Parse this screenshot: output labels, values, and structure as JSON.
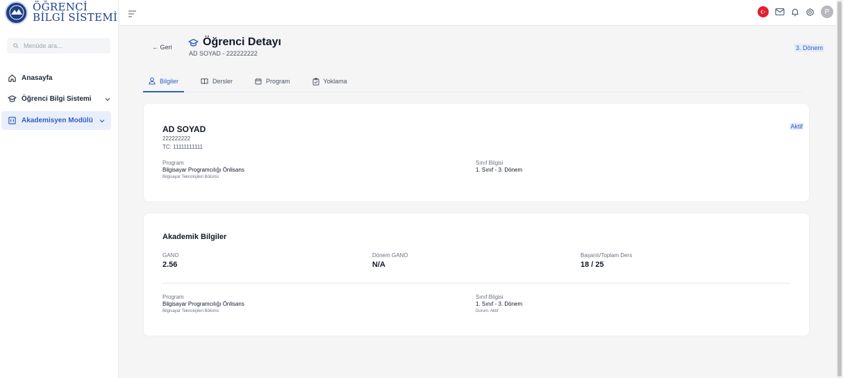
{
  "app": {
    "logo_line1": "ÖĞRENCİ",
    "logo_line2": "BİLGİ SİSTEMİ"
  },
  "sidebar": {
    "search_placeholder": "Menüde ara...",
    "items": [
      {
        "label": "Anasayfa",
        "icon": "home-icon"
      },
      {
        "label": "Öğrenci Bilgi Sistemi",
        "icon": "graduation-cap-icon"
      },
      {
        "label": "Akademisyen Modülü",
        "icon": "building-icon"
      }
    ]
  },
  "topbar": {
    "avatar_initial": "P"
  },
  "header": {
    "back_label": "← Geri",
    "title": "Öğrenci Detayı",
    "subtitle": "AD SOYAD - 222222222",
    "term_badge": "3. Dönem"
  },
  "tabs": [
    {
      "label": "Bilgiler",
      "active": true
    },
    {
      "label": "Dersler",
      "active": false
    },
    {
      "label": "Program",
      "active": false
    },
    {
      "label": "Yoklama",
      "active": false
    }
  ],
  "student": {
    "name": "AD SOYAD",
    "number": "222222222",
    "tc": "TC: 11111111111",
    "status": "Aktif",
    "program_label": "Program",
    "program_value": "Bilgisayar Programcılığı Önlisans",
    "program_dept": "Bilgisayar Teknolojileri Bölümü",
    "class_label": "Sınıf Bilgisi",
    "class_value": "1. Sınıf - 3. Dönem"
  },
  "academic": {
    "title": "Akademik Bilgiler",
    "gano_label": "GANO",
    "gano_value": "2.56",
    "term_gano_label": "Dönem GANO",
    "term_gano_value": "N/A",
    "courses_label": "Başarılı/Toplam Ders",
    "courses_value": "18 / 25",
    "program_label": "Program",
    "program_value": "Bilgisayar Programcılığı Önlisans",
    "program_dept": "Bilgisayar Teknolojileri Bölümü",
    "class_label": "Sınıf Bilgisi",
    "class_value": "1. Sınıf - 3. Dönem",
    "status_text": "Durum: Aktif"
  },
  "colors": {
    "accent": "#2f5ec4",
    "brand": "#1d3f8a",
    "flag": "#e11d2e"
  }
}
